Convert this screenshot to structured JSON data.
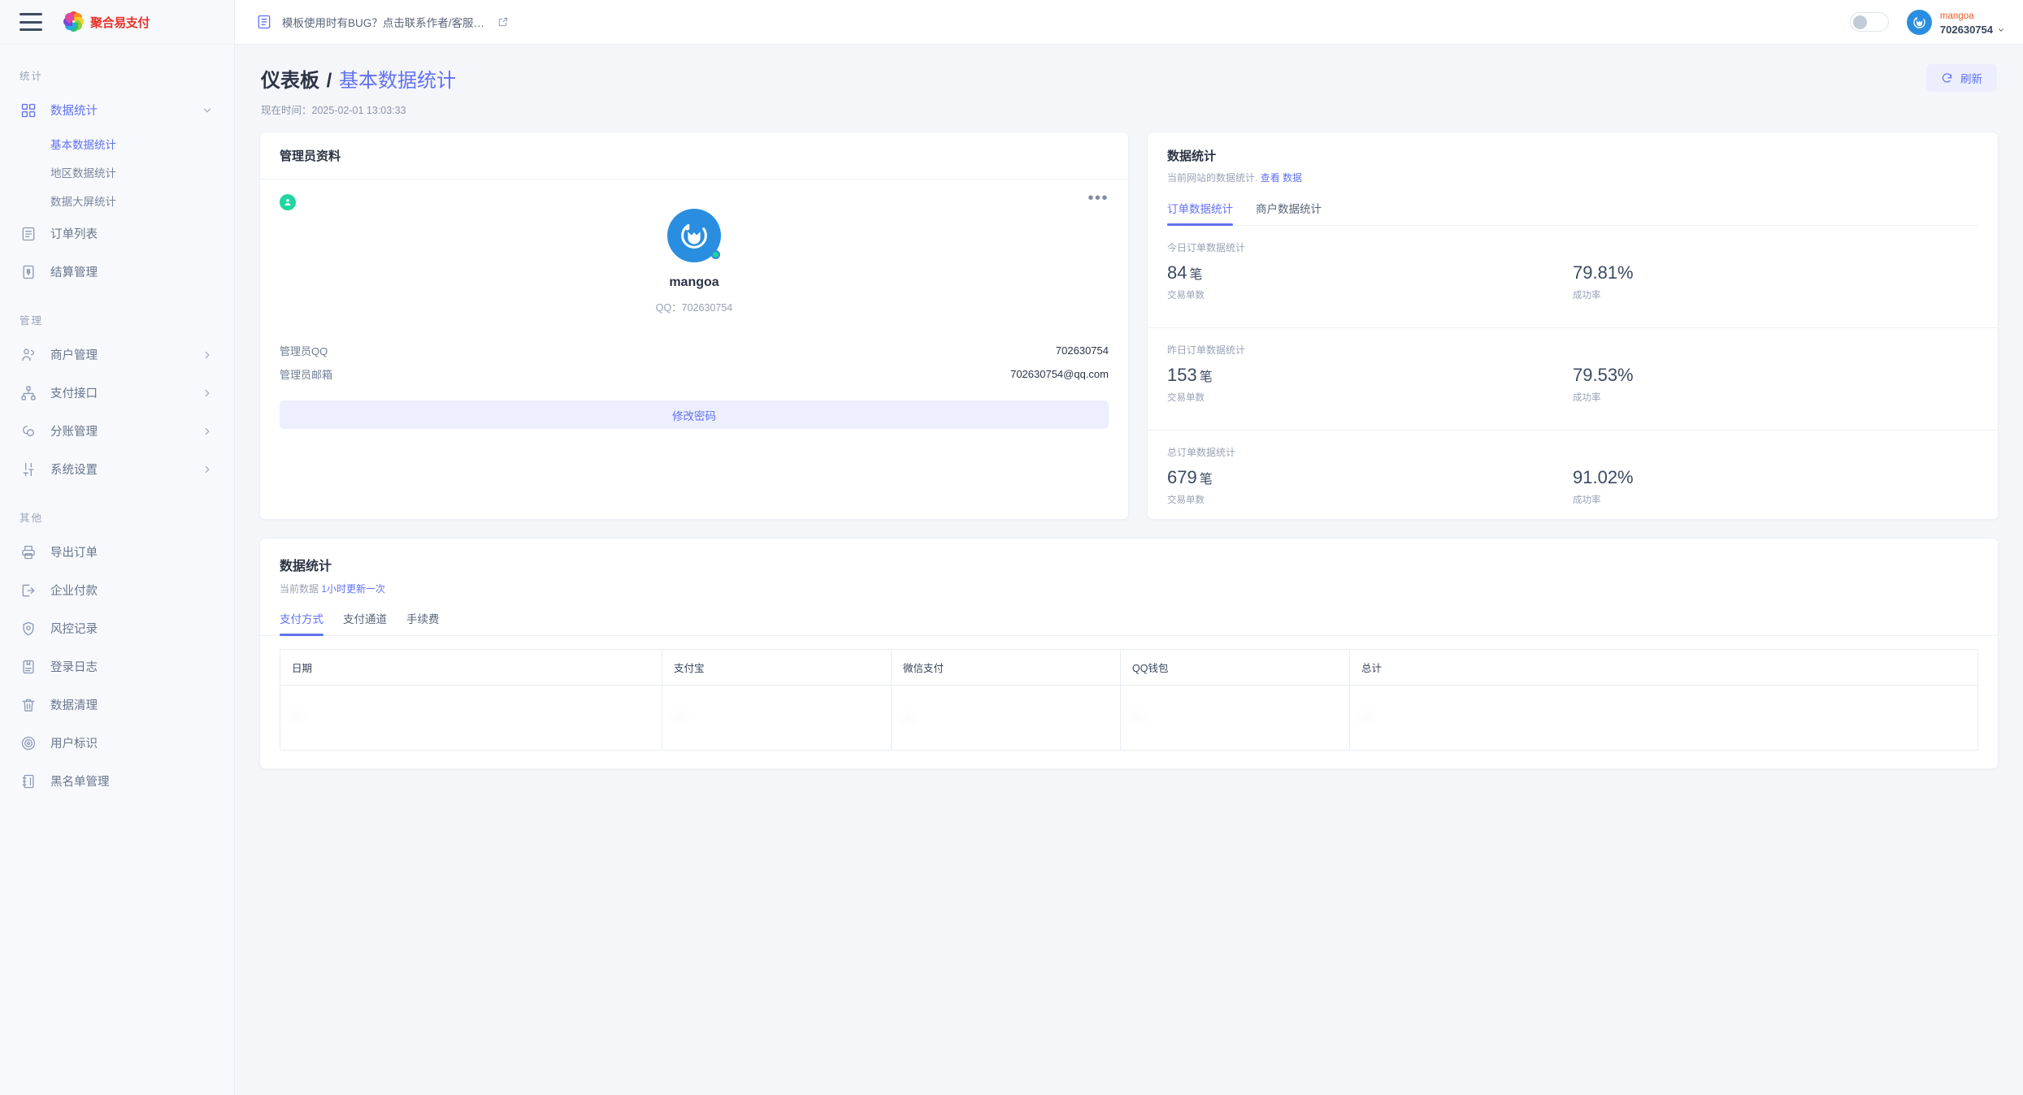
{
  "brand": {
    "name": "聚合易支付"
  },
  "topbar": {
    "notice_text": "模板使用时有BUG？点击联系作者/客服…",
    "user": {
      "name": "mangoa",
      "id": "702630754"
    }
  },
  "sidebar": {
    "groups": [
      {
        "title": "统计",
        "items": [
          {
            "label": "数据统计",
            "icon": "grid-icon",
            "expandable": true,
            "active": true,
            "children": [
              {
                "label": "基本数据统计",
                "active": true
              },
              {
                "label": "地区数据统计",
                "active": false
              },
              {
                "label": "数据大屏统计",
                "active": false
              }
            ]
          },
          {
            "label": "订单列表",
            "icon": "list-icon",
            "expandable": false,
            "active": false
          },
          {
            "label": "结算管理",
            "icon": "receipt-icon",
            "expandable": false,
            "active": false
          }
        ]
      },
      {
        "title": "管理",
        "items": [
          {
            "label": "商户管理",
            "icon": "users-icon",
            "expandable": true,
            "active": false
          },
          {
            "label": "支付接口",
            "icon": "sitemap-icon",
            "expandable": true,
            "active": false
          },
          {
            "label": "分账管理",
            "icon": "share-icon",
            "expandable": true,
            "active": false
          },
          {
            "label": "系统设置",
            "icon": "sliders-icon",
            "expandable": true,
            "active": false
          }
        ]
      },
      {
        "title": "其他",
        "items": [
          {
            "label": "导出订单",
            "icon": "printer-icon",
            "expandable": false,
            "active": false
          },
          {
            "label": "企业付款",
            "icon": "export-icon",
            "expandable": false,
            "active": false
          },
          {
            "label": "风控记录",
            "icon": "shield-icon",
            "expandable": false,
            "active": false
          },
          {
            "label": "登录日志",
            "icon": "book-icon",
            "expandable": false,
            "active": false
          },
          {
            "label": "数据清理",
            "icon": "trash-icon",
            "expandable": false,
            "active": false
          },
          {
            "label": "用户标识",
            "icon": "target-icon",
            "expandable": false,
            "active": false
          },
          {
            "label": "黑名单管理",
            "icon": "blacklist-icon",
            "expandable": false,
            "active": false
          }
        ]
      }
    ]
  },
  "page": {
    "breadcrumb_root": "仪表板",
    "breadcrumb_sep": "/",
    "breadcrumb_current": "基本数据统计",
    "time_label": "现在时间：",
    "time_value": "2025-02-01 13:03:33",
    "refresh_label": "刷新"
  },
  "profile_card": {
    "title": "管理员资料",
    "name": "mangoa",
    "qq_line": "QQ：702630754",
    "rows": [
      {
        "key": "管理员QQ",
        "value": "702630754"
      },
      {
        "key": "管理员邮箱",
        "value": "702630754@qq.com"
      }
    ],
    "change_password_label": "修改密码"
  },
  "stats_card": {
    "title": "数据统计",
    "subtitle_prefix": "当前网站的数据统计.",
    "subtitle_link": "查看 数据",
    "tabs": [
      {
        "label": "订单数据统计",
        "active": true
      },
      {
        "label": "商户数据统计",
        "active": false
      }
    ],
    "blocks": [
      {
        "label": "今日订单数据统计",
        "count": "84",
        "count_unit": "笔",
        "count_caption": "交易单数",
        "rate": "79.81%",
        "rate_caption": "成功率"
      },
      {
        "label": "昨日订单数据统计",
        "count": "153",
        "count_unit": "笔",
        "count_caption": "交易单数",
        "rate": "79.53%",
        "rate_caption": "成功率"
      },
      {
        "label": "总订单数据统计",
        "count": "679",
        "count_unit": "笔",
        "count_caption": "交易单数",
        "rate": "91.02%",
        "rate_caption": "成功率"
      }
    ]
  },
  "bottom_card": {
    "title": "数据统计",
    "subtitle_prefix": "当前数据",
    "subtitle_link": "1小时更新一次",
    "tabs": [
      {
        "label": "支付方式",
        "active": true
      },
      {
        "label": "支付通道",
        "active": false
      },
      {
        "label": "手续费",
        "active": false
      }
    ],
    "table": {
      "columns": [
        "日期",
        "支付宝",
        "微信支付",
        "QQ钱包",
        "总计"
      ],
      "rows": [
        {
          "cells": [
            "—",
            "—",
            "—",
            "—",
            "—"
          ],
          "redacted": true
        }
      ]
    }
  },
  "colors": {
    "accent": "#6172f3",
    "brand_red": "#e8322a",
    "avatar_blue": "#2a8ee0",
    "online_green": "#22d39a",
    "orange_name": "#f05a28"
  }
}
